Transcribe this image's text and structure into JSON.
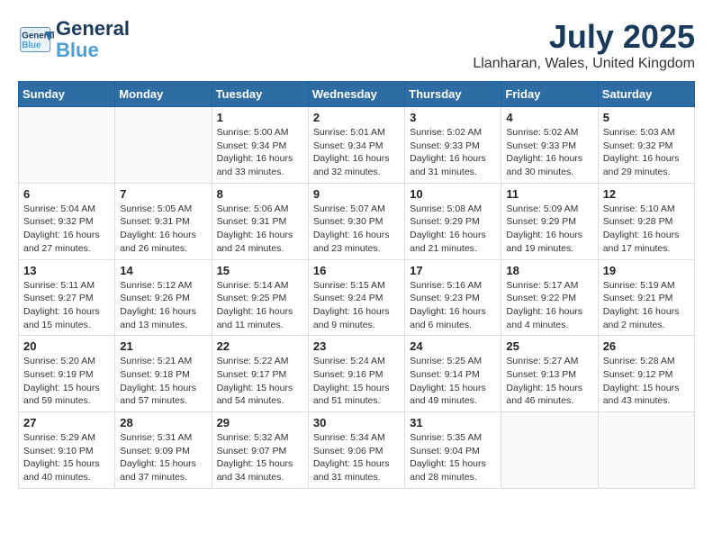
{
  "header": {
    "logo_line1": "General",
    "logo_line2": "Blue",
    "month": "July 2025",
    "location": "Llanharan, Wales, United Kingdom"
  },
  "weekdays": [
    "Sunday",
    "Monday",
    "Tuesday",
    "Wednesday",
    "Thursday",
    "Friday",
    "Saturday"
  ],
  "weeks": [
    [
      {
        "day": "",
        "sunrise": "",
        "sunset": "",
        "daylight": ""
      },
      {
        "day": "",
        "sunrise": "",
        "sunset": "",
        "daylight": ""
      },
      {
        "day": "1",
        "sunrise": "Sunrise: 5:00 AM",
        "sunset": "Sunset: 9:34 PM",
        "daylight": "Daylight: 16 hours and 33 minutes."
      },
      {
        "day": "2",
        "sunrise": "Sunrise: 5:01 AM",
        "sunset": "Sunset: 9:34 PM",
        "daylight": "Daylight: 16 hours and 32 minutes."
      },
      {
        "day": "3",
        "sunrise": "Sunrise: 5:02 AM",
        "sunset": "Sunset: 9:33 PM",
        "daylight": "Daylight: 16 hours and 31 minutes."
      },
      {
        "day": "4",
        "sunrise": "Sunrise: 5:02 AM",
        "sunset": "Sunset: 9:33 PM",
        "daylight": "Daylight: 16 hours and 30 minutes."
      },
      {
        "day": "5",
        "sunrise": "Sunrise: 5:03 AM",
        "sunset": "Sunset: 9:32 PM",
        "daylight": "Daylight: 16 hours and 29 minutes."
      }
    ],
    [
      {
        "day": "6",
        "sunrise": "Sunrise: 5:04 AM",
        "sunset": "Sunset: 9:32 PM",
        "daylight": "Daylight: 16 hours and 27 minutes."
      },
      {
        "day": "7",
        "sunrise": "Sunrise: 5:05 AM",
        "sunset": "Sunset: 9:31 PM",
        "daylight": "Daylight: 16 hours and 26 minutes."
      },
      {
        "day": "8",
        "sunrise": "Sunrise: 5:06 AM",
        "sunset": "Sunset: 9:31 PM",
        "daylight": "Daylight: 16 hours and 24 minutes."
      },
      {
        "day": "9",
        "sunrise": "Sunrise: 5:07 AM",
        "sunset": "Sunset: 9:30 PM",
        "daylight": "Daylight: 16 hours and 23 minutes."
      },
      {
        "day": "10",
        "sunrise": "Sunrise: 5:08 AM",
        "sunset": "Sunset: 9:29 PM",
        "daylight": "Daylight: 16 hours and 21 minutes."
      },
      {
        "day": "11",
        "sunrise": "Sunrise: 5:09 AM",
        "sunset": "Sunset: 9:29 PM",
        "daylight": "Daylight: 16 hours and 19 minutes."
      },
      {
        "day": "12",
        "sunrise": "Sunrise: 5:10 AM",
        "sunset": "Sunset: 9:28 PM",
        "daylight": "Daylight: 16 hours and 17 minutes."
      }
    ],
    [
      {
        "day": "13",
        "sunrise": "Sunrise: 5:11 AM",
        "sunset": "Sunset: 9:27 PM",
        "daylight": "Daylight: 16 hours and 15 minutes."
      },
      {
        "day": "14",
        "sunrise": "Sunrise: 5:12 AM",
        "sunset": "Sunset: 9:26 PM",
        "daylight": "Daylight: 16 hours and 13 minutes."
      },
      {
        "day": "15",
        "sunrise": "Sunrise: 5:14 AM",
        "sunset": "Sunset: 9:25 PM",
        "daylight": "Daylight: 16 hours and 11 minutes."
      },
      {
        "day": "16",
        "sunrise": "Sunrise: 5:15 AM",
        "sunset": "Sunset: 9:24 PM",
        "daylight": "Daylight: 16 hours and 9 minutes."
      },
      {
        "day": "17",
        "sunrise": "Sunrise: 5:16 AM",
        "sunset": "Sunset: 9:23 PM",
        "daylight": "Daylight: 16 hours and 6 minutes."
      },
      {
        "day": "18",
        "sunrise": "Sunrise: 5:17 AM",
        "sunset": "Sunset: 9:22 PM",
        "daylight": "Daylight: 16 hours and 4 minutes."
      },
      {
        "day": "19",
        "sunrise": "Sunrise: 5:19 AM",
        "sunset": "Sunset: 9:21 PM",
        "daylight": "Daylight: 16 hours and 2 minutes."
      }
    ],
    [
      {
        "day": "20",
        "sunrise": "Sunrise: 5:20 AM",
        "sunset": "Sunset: 9:19 PM",
        "daylight": "Daylight: 15 hours and 59 minutes."
      },
      {
        "day": "21",
        "sunrise": "Sunrise: 5:21 AM",
        "sunset": "Sunset: 9:18 PM",
        "daylight": "Daylight: 15 hours and 57 minutes."
      },
      {
        "day": "22",
        "sunrise": "Sunrise: 5:22 AM",
        "sunset": "Sunset: 9:17 PM",
        "daylight": "Daylight: 15 hours and 54 minutes."
      },
      {
        "day": "23",
        "sunrise": "Sunrise: 5:24 AM",
        "sunset": "Sunset: 9:16 PM",
        "daylight": "Daylight: 15 hours and 51 minutes."
      },
      {
        "day": "24",
        "sunrise": "Sunrise: 5:25 AM",
        "sunset": "Sunset: 9:14 PM",
        "daylight": "Daylight: 15 hours and 49 minutes."
      },
      {
        "day": "25",
        "sunrise": "Sunrise: 5:27 AM",
        "sunset": "Sunset: 9:13 PM",
        "daylight": "Daylight: 15 hours and 46 minutes."
      },
      {
        "day": "26",
        "sunrise": "Sunrise: 5:28 AM",
        "sunset": "Sunset: 9:12 PM",
        "daylight": "Daylight: 15 hours and 43 minutes."
      }
    ],
    [
      {
        "day": "27",
        "sunrise": "Sunrise: 5:29 AM",
        "sunset": "Sunset: 9:10 PM",
        "daylight": "Daylight: 15 hours and 40 minutes."
      },
      {
        "day": "28",
        "sunrise": "Sunrise: 5:31 AM",
        "sunset": "Sunset: 9:09 PM",
        "daylight": "Daylight: 15 hours and 37 minutes."
      },
      {
        "day": "29",
        "sunrise": "Sunrise: 5:32 AM",
        "sunset": "Sunset: 9:07 PM",
        "daylight": "Daylight: 15 hours and 34 minutes."
      },
      {
        "day": "30",
        "sunrise": "Sunrise: 5:34 AM",
        "sunset": "Sunset: 9:06 PM",
        "daylight": "Daylight: 15 hours and 31 minutes."
      },
      {
        "day": "31",
        "sunrise": "Sunrise: 5:35 AM",
        "sunset": "Sunset: 9:04 PM",
        "daylight": "Daylight: 15 hours and 28 minutes."
      },
      {
        "day": "",
        "sunrise": "",
        "sunset": "",
        "daylight": ""
      },
      {
        "day": "",
        "sunrise": "",
        "sunset": "",
        "daylight": ""
      }
    ]
  ]
}
